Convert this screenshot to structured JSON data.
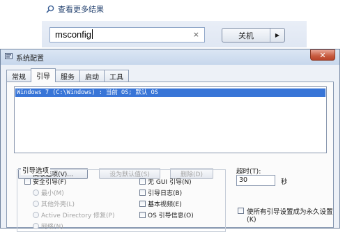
{
  "start_menu": {
    "see_more": "查看更多结果",
    "search_value": "msconfig",
    "clear_symbol": "×",
    "shutdown_label": "关机",
    "shutdown_arrow": "▶"
  },
  "window": {
    "title": "系统配置",
    "close_symbol": "✕",
    "tabs": [
      {
        "label": "常规"
      },
      {
        "label": "引导"
      },
      {
        "label": "服务"
      },
      {
        "label": "启动"
      },
      {
        "label": "工具"
      }
    ],
    "active_tab": "引导",
    "boot_entries": [
      "Windows 7 (C:\\Windows) : 当前 OS; 默认 OS"
    ],
    "buttons": {
      "advanced": "高级选项(V)...",
      "set_default": "设为默认值(S)",
      "delete": "删除(D)"
    },
    "boot_options": {
      "legend": "引导选项",
      "safe_boot": "安全引导(F)",
      "minimal": "最小(M)",
      "alternate_shell": "其他外壳(L)",
      "active_directory": "Active Directory 修复(P)",
      "network": "网络(N)",
      "no_gui": "无 GUI 引导(N)",
      "boot_log": "引导日志(B)",
      "base_video": "基本视频(E)",
      "os_info": "OS 引导信息(O)"
    },
    "timeout": {
      "label": "超时(T):",
      "value": "30",
      "unit": "秒"
    },
    "permanent": "使所有引导设置成为永久设置(K)"
  }
}
